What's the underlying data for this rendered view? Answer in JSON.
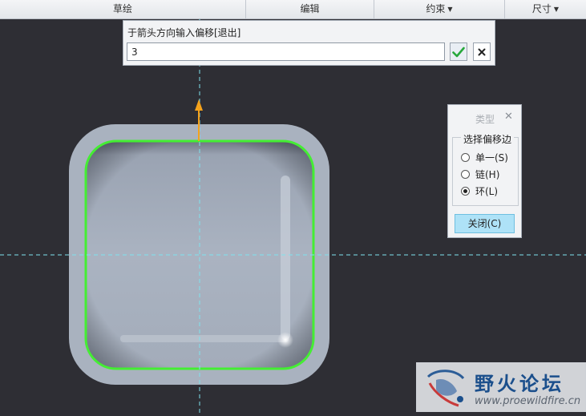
{
  "ribbon": {
    "groups": [
      {
        "label": "草绘",
        "dropdown": false
      },
      {
        "label": "编辑",
        "dropdown": false
      },
      {
        "label": "约束",
        "dropdown": true
      },
      {
        "label": "尺寸",
        "dropdown": true
      }
    ]
  },
  "offset_prompt": {
    "label": "于箭头方向输入偏移[退出]",
    "value": "3",
    "ok_icon": "check-icon",
    "cancel_icon": "x-icon"
  },
  "type_panel": {
    "title": "类型",
    "legend": "选择偏移边",
    "options": [
      {
        "label": "单一(S)",
        "checked": false
      },
      {
        "label": "链(H)",
        "checked": false
      },
      {
        "label": "环(L)",
        "checked": true
      }
    ],
    "close_label": "关闭(C)"
  },
  "watermark": {
    "title": "野火论坛",
    "url": "www.proewildfire.cn"
  },
  "colors": {
    "viewport_bg": "#2e2e34",
    "selection": "#44ee33",
    "arrow": "#f5a21b",
    "centerline": "#7fe3ee",
    "ok_check": "#27a83b"
  }
}
